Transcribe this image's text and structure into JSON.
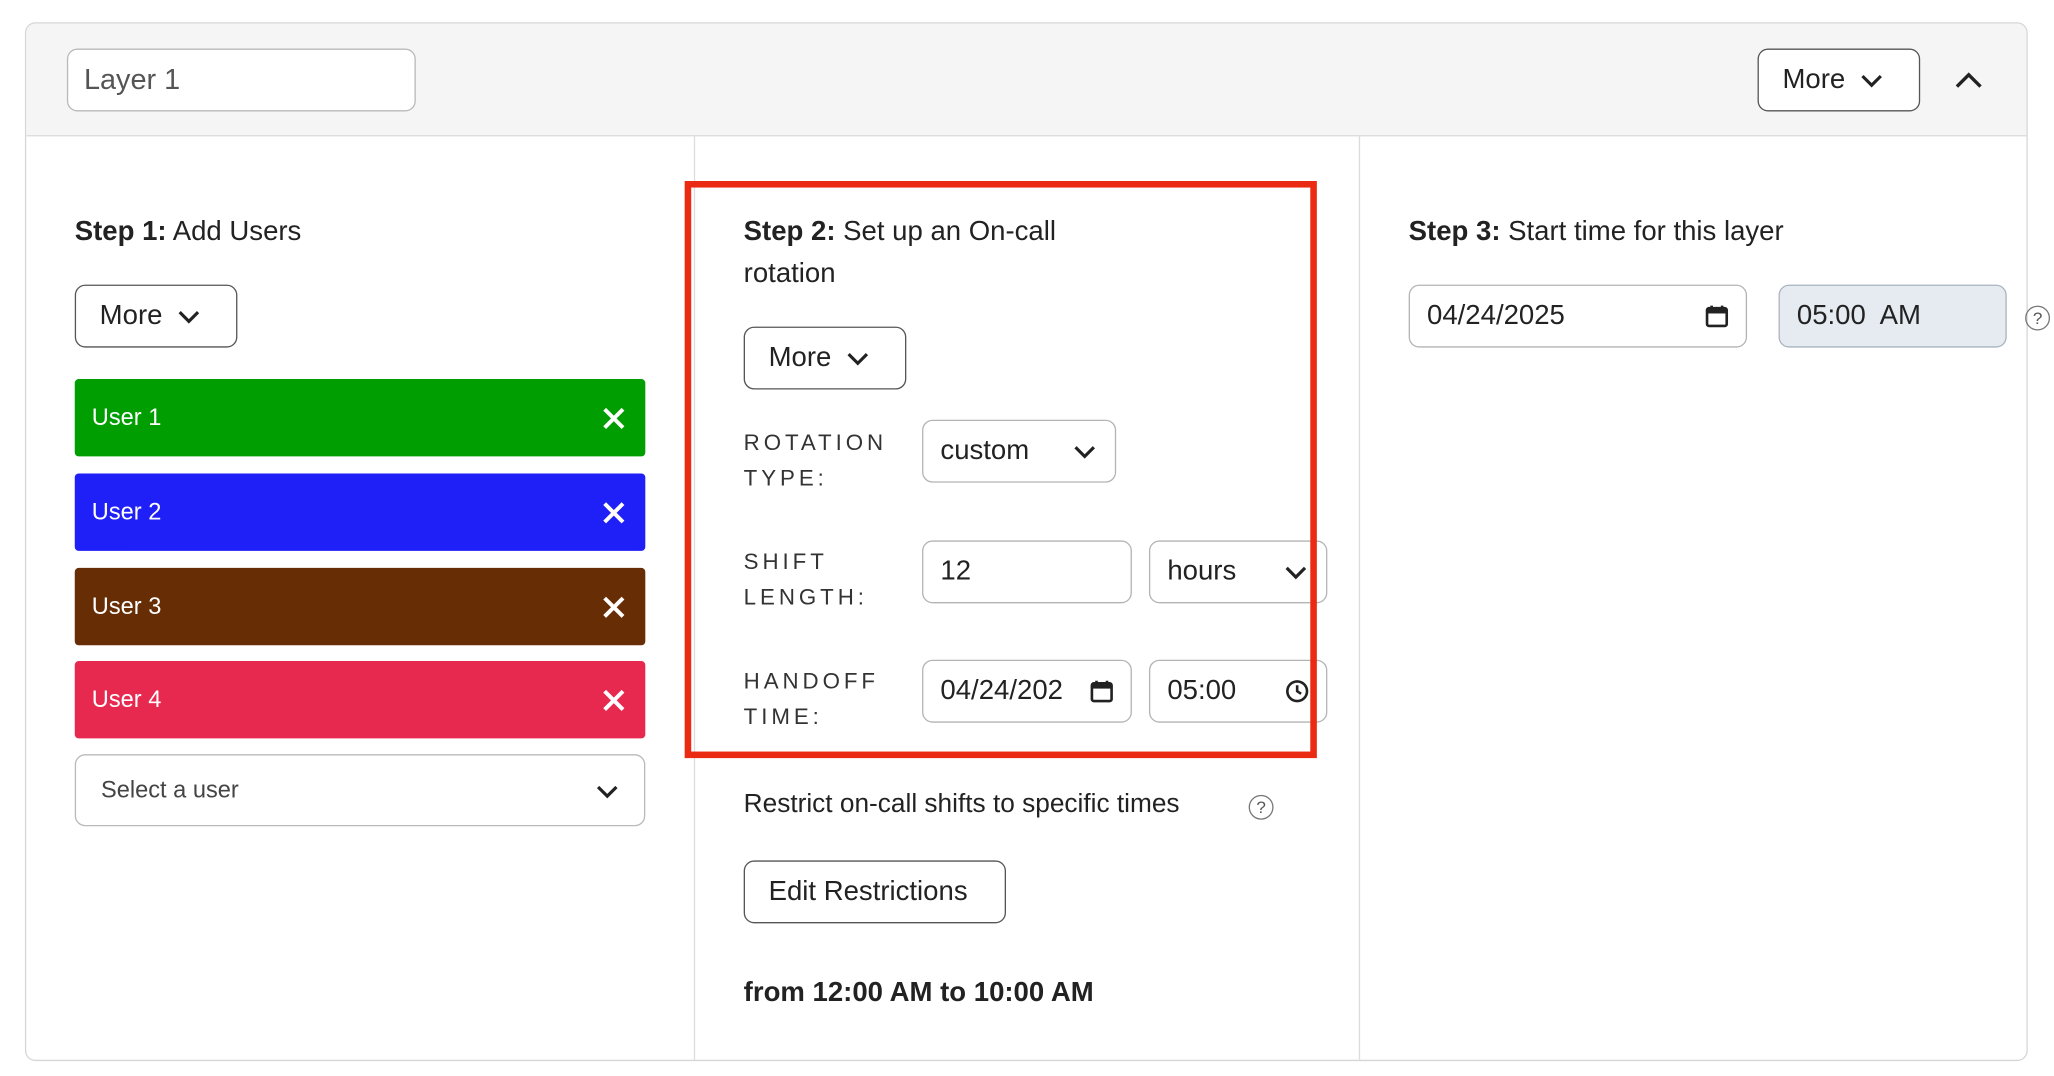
{
  "header": {
    "layer_name": "Layer 1",
    "more_label": "More",
    "collapse_icon": "chevron-up-icon"
  },
  "step1": {
    "title_bold": "Step 1:",
    "title_rest": "Add Users",
    "more_label": "More",
    "users": [
      {
        "label": "User 1",
        "color": "#009e00"
      },
      {
        "label": "User 2",
        "color": "#1f1ff8"
      },
      {
        "label": "User 3",
        "color": "#672d05"
      },
      {
        "label": "User 4",
        "color": "#e8294f"
      }
    ],
    "select_placeholder": "Select a user"
  },
  "step2": {
    "title_bold": "Step 2:",
    "title_rest_line1": "Set up an On-call",
    "title_rest_line2": "rotation",
    "more_label": "More",
    "rotation_label_1": "ROTATION",
    "rotation_label_2": "TYPE:",
    "rotation_value": "custom",
    "shift_label_1": "SHIFT",
    "shift_label_2": "LENGTH:",
    "shift_value": "12",
    "shift_unit": "hours",
    "handoff_label_1": "HANDOFF",
    "handoff_label_2": "TIME:",
    "handoff_date": "04/24/202",
    "handoff_time": "05:00",
    "restrict_text": "Restrict on-call shifts to specific times",
    "edit_restrictions_label": "Edit Restrictions",
    "restriction_summary": "from 12:00 AM to 10:00 AM",
    "highlight_color": "#ea2a12"
  },
  "step3": {
    "title_bold": "Step 3:",
    "title_rest": "Start time for this layer",
    "start_date": "04/24/2025",
    "start_time": "05:00  AM"
  }
}
